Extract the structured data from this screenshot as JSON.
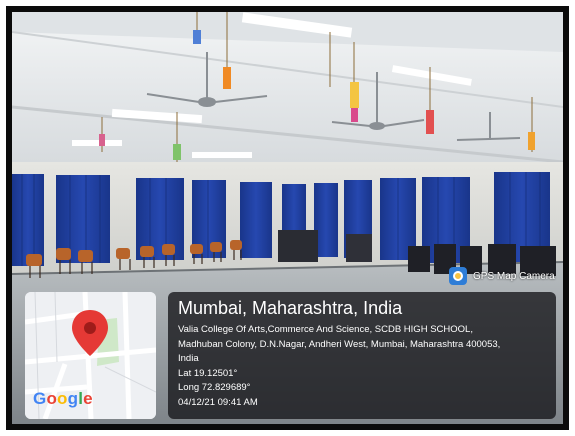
{
  "badge": {
    "label": "GPS Map Camera",
    "icon": "gps-map-camera-icon"
  },
  "location": {
    "city": "Mumbai, Maharashtra, India",
    "address_lines": [
      "Valia College Of Arts,Commerce And Science, SCDB HIGH SCHOOL,",
      "Madhuban Colony, D.N.Nagar, Andheri West, Mumbai, Maharashtra 400053,",
      "India"
    ],
    "latitude": "Lat 19.12501°",
    "longitude": "Long 72.829689°",
    "timestamp": "04/12/21 09:41 AM"
  },
  "map": {
    "logo_text": "Google",
    "pin_icon": "map-pin-icon",
    "logo_colors": [
      "#4285F4",
      "#EA4335",
      "#FBBC05",
      "#4285F4",
      "#34A853",
      "#EA4335"
    ]
  },
  "colors": {
    "curtain": "#1f3f9e",
    "ceiling": "#e9ecef",
    "floor": "#9aa0a4"
  }
}
